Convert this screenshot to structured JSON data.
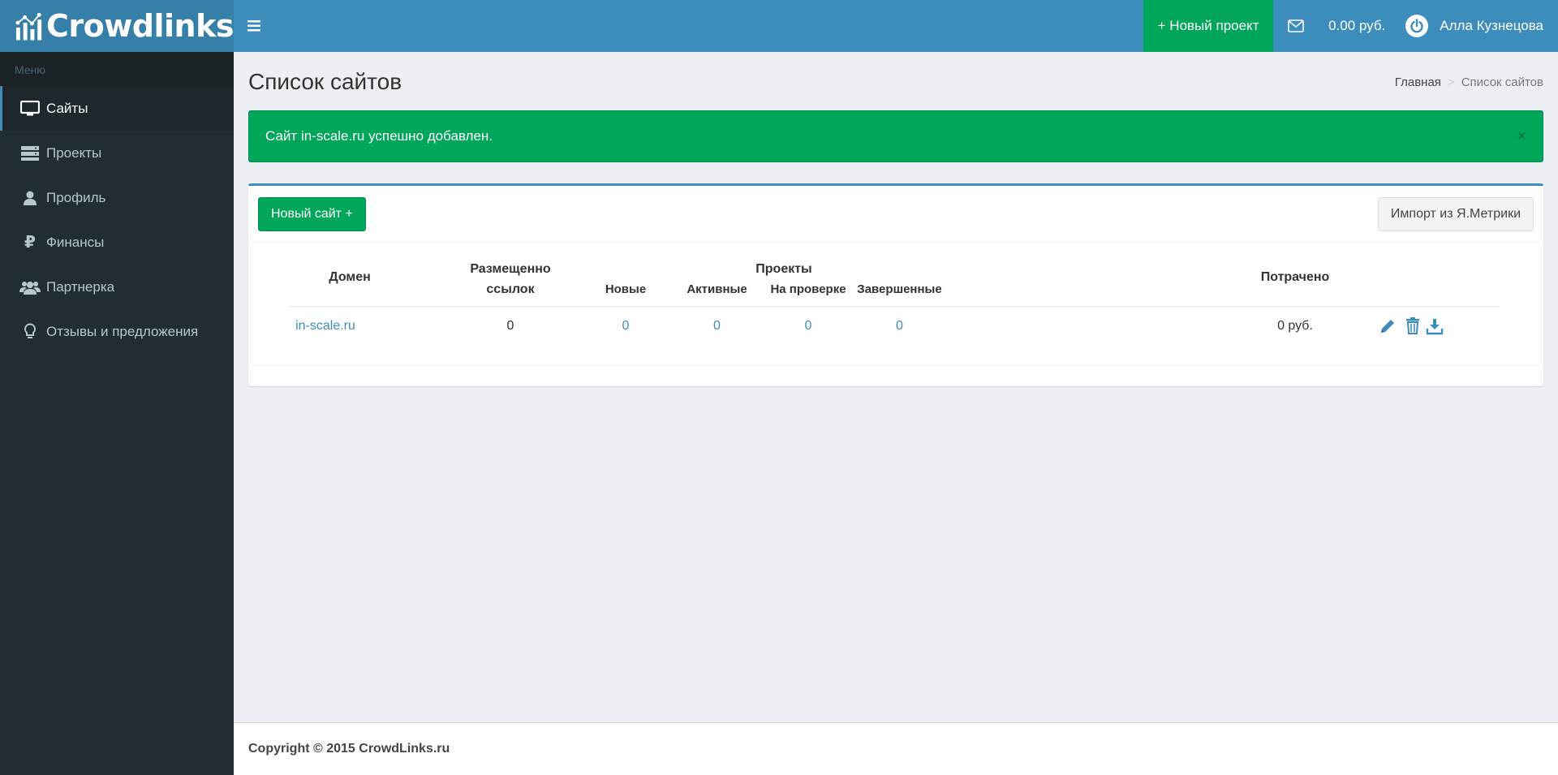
{
  "app": {
    "logo_text": "Crowdlinks"
  },
  "header": {
    "new_project_label": "+ Новый проект",
    "balance": "0.00 руб.",
    "user_name": "Алла Кузнецова"
  },
  "sidebar": {
    "header": "Меню",
    "items": [
      {
        "label": "Сайты",
        "icon": "desktop-icon",
        "active": true
      },
      {
        "label": "Проекты",
        "icon": "server-icon"
      },
      {
        "label": "Профиль",
        "icon": "user-icon"
      },
      {
        "label": "Финансы",
        "icon": "ruble-icon"
      },
      {
        "label": "Партнерка",
        "icon": "users-icon"
      },
      {
        "label": "Отзывы и предложения",
        "icon": "lightbulb-icon"
      }
    ]
  },
  "page": {
    "title": "Список сайтов",
    "breadcrumb": {
      "home": "Главная",
      "current": "Список сайтов"
    }
  },
  "alert": {
    "message": "Сайт in-scale.ru успешно добавлен.",
    "close": "×"
  },
  "box": {
    "new_site_label": "Новый сайт +",
    "import_label": "Импорт из Я.Метрики"
  },
  "table": {
    "headers": {
      "domain": "Домен",
      "placed_line1": "Размещенно",
      "placed_line2": "ссылок",
      "projects": "Проекты",
      "new": "Новые",
      "active": "Активные",
      "review": "На проверке",
      "done": "Завершенные",
      "spent": "Потрачено"
    },
    "rows": [
      {
        "domain": "in-scale.ru",
        "placed": "0",
        "new": "0",
        "active": "0",
        "review": "0",
        "done": "0",
        "spent": "0 руб."
      }
    ]
  },
  "footer": {
    "copyright": "Copyright © 2015 CrowdLinks.ru"
  },
  "colors": {
    "primary": "#3c8dbc",
    "success": "#00a65a",
    "sidebar": "#222d32"
  }
}
